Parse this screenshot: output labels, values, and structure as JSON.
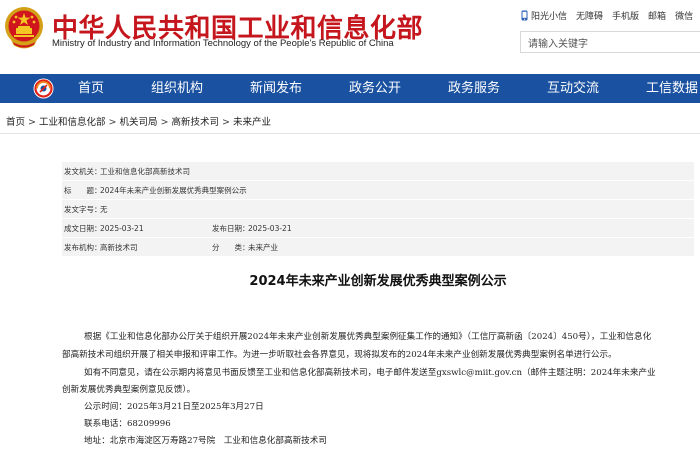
{
  "header": {
    "site_title": "中华人民共和国工业和信息化部",
    "site_subtitle": "Ministry of Industry and Information Technology of the People's Republic of China",
    "top_links": [
      "阳光小信",
      "无障碍",
      "手机版",
      "邮箱",
      "微信"
    ],
    "search_placeholder": "请输入关键字"
  },
  "nav": {
    "items": [
      "首页",
      "组织机构",
      "新闻发布",
      "政务公开",
      "政务服务",
      "互动交流",
      "工信数据"
    ]
  },
  "breadcrumb": {
    "items": [
      "首页",
      "工业和信息化部",
      "机关司局",
      "高新技术司",
      "未来产业"
    ],
    "separator": ">"
  },
  "meta": {
    "rows": [
      {
        "k1": "发文机关：",
        "v1": "工业和信息化部高新技术司"
      },
      {
        "k1": "标　　题：",
        "v1": "2024年未来产业创新发展优秀典型案例公示"
      },
      {
        "k1": "发文字号：",
        "v1": "无"
      },
      {
        "k1": "成文日期：",
        "v1": "2025-03-21",
        "k2": "发布日期：",
        "v2": "2025-03-21"
      },
      {
        "k1": "发布机构：",
        "v1": "高新技术司",
        "k2": "分　　类：",
        "v2": "未来产业"
      }
    ]
  },
  "article": {
    "title": "2024年未来产业创新发展优秀典型案例公示",
    "lines": [
      "根据《工业和信息化部办公厅关于组织开展2024年未来产业创新发展优秀典型案例征集工作的通知》（工信厅高新函〔2024〕450号），工业和信息化",
      "部高新技术司组织开展了相关申报和评审工作。为进一步听取社会各界意见，现将拟发布的2024年未来产业创新发展优秀典型案例名单进行公示。",
      "如有不同意见，请在公示期内将意见书面反馈至工业和信息化部高新技术司，电子邮件发送至gxswlc@miit.gov.cn（邮件主题注明：2024年未来产业",
      "创新发展优秀典型案例意见反馈）。",
      "公示时间：2025年3月21日至2025年3月27日",
      "联系电话：68209996",
      "地址：北京市海淀区万寿路27号院　工业和信息化部高新技术司"
    ]
  },
  "colors": {
    "brand_red": "#c4161c",
    "nav_blue": "#1a51a0",
    "meta_bg": "#f3f3f3"
  },
  "icons": {
    "emblem": "national-emblem",
    "nav_logo": "miit-logo",
    "top_link_first": "phone-icon"
  }
}
